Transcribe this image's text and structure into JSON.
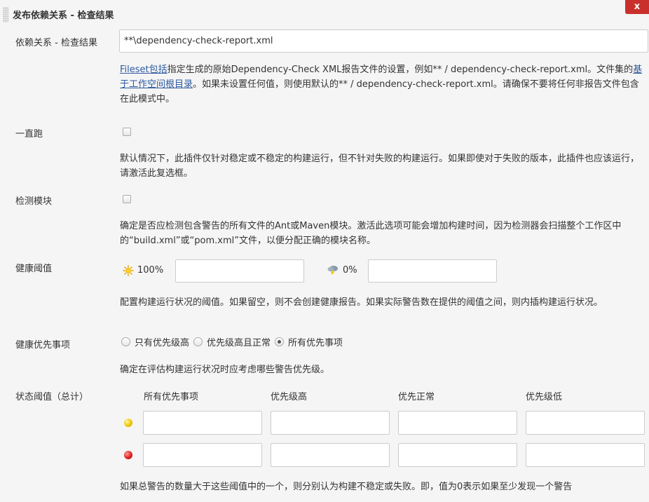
{
  "header": {
    "title": "发布依赖关系 - 检查结果",
    "close_label": "x"
  },
  "pattern": {
    "label": "依赖关系 - 检查结果",
    "value": "**\\dependency-check-report.xml",
    "help_link1": "Fileset包括",
    "help_text1": "指定生成的原始Dependency-Check XML报告文件的设置，例如** / dependency-check-report.xml。文件集的",
    "help_link2": "基于工作空间根目录",
    "help_text2": "。如果未设置任何值，则使用默认的** / dependency-check-report.xml。请确保不要将任何非报告文件包含在此模式中。"
  },
  "run_always": {
    "label": "一直跑",
    "checked": false,
    "help": "默认情况下，此插件仅针对稳定或不稳定的构建运行，但不针对失败的构建运行。如果即使对于失败的版本，此插件也应该运行，请激活此复选框。"
  },
  "detect_modules": {
    "label": "检测模块",
    "checked": false,
    "help": "确定是否应检测包含警告的所有文件的Ant或Maven模块。激活此选项可能会增加构建时间，因为检测器会扫描整个工作区中的“build.xml”或“pom.xml”文件，以便分配正确的模块名称。"
  },
  "health": {
    "label": "健康阈值",
    "healthy_pct": "100%",
    "healthy_value": "",
    "unhealthy_pct": "0%",
    "unhealthy_value": "",
    "help": "配置构建运行状况的阈值。如果留空，则不会创建健康报告。如果实际警告数在提供的阈值之间，则内插构建运行状况。"
  },
  "health_priority": {
    "label": "健康优先事项",
    "options": [
      "只有优先级高",
      "优先级高且正常",
      "所有优先事项"
    ],
    "selected": 2,
    "help": "确定在评估构建运行状况时应考虑哪些警告优先级。"
  },
  "status_thresholds": {
    "label": "状态阈值（总计）",
    "columns": [
      "所有优先事项",
      "优先级高",
      "优先正常",
      "优先级低"
    ],
    "unstable_values": [
      "",
      "",
      "",
      ""
    ],
    "failed_values": [
      "",
      "",
      "",
      ""
    ],
    "help": "如果总警告的数量大于这些阈值中的一个，则分别认为构建不稳定或失败。即，值为0表示如果至少发现一个警告"
  },
  "colors": {
    "link": "#2c5aa0",
    "close": "#c9302c"
  }
}
